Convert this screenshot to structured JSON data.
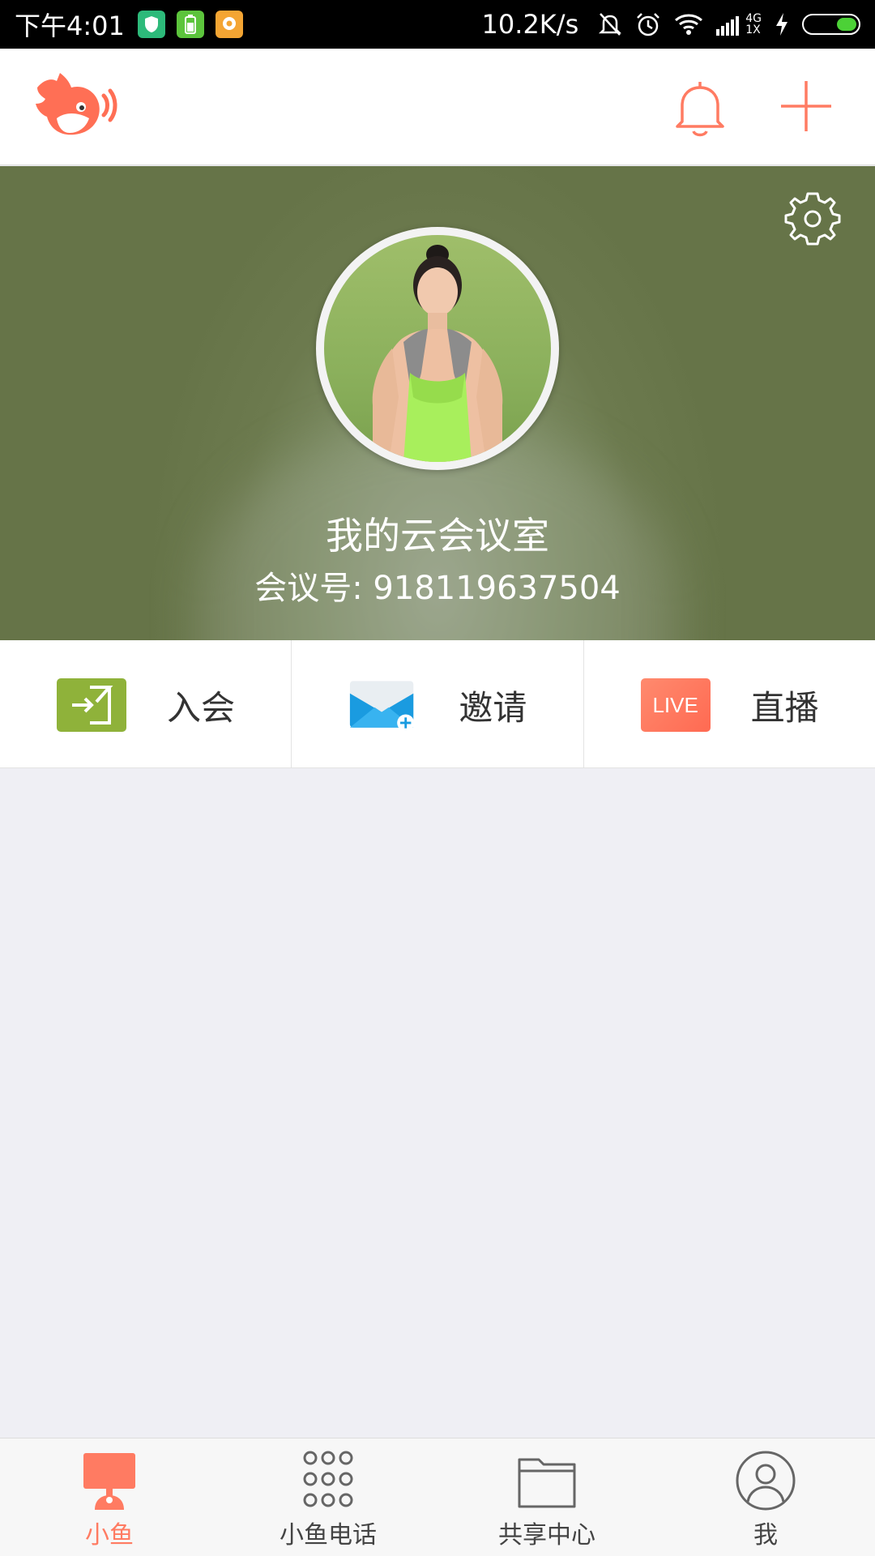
{
  "status_bar": {
    "time": "下午4:01",
    "network_speed": "10.2K/s",
    "signal_top": "4G",
    "signal_bottom": "1X",
    "battery_level": 0.35,
    "app_icons": [
      "shield-app-icon",
      "battery-app-icon",
      "chat-app-icon"
    ]
  },
  "top_bar": {
    "logo": "fish-logo-icon",
    "notification_icon": "bell-icon",
    "add_icon": "plus-icon"
  },
  "hero": {
    "settings_icon": "gear-icon",
    "room_title": "我的云会议室",
    "room_number_label": "会议号: 918119637504"
  },
  "actions": [
    {
      "label": "入会",
      "icon": "join-icon",
      "color": "#8fb23a"
    },
    {
      "label": "邀请",
      "icon": "envelope-icon",
      "color": "#1a9be0"
    },
    {
      "label": "直播",
      "icon": "live-icon",
      "icon_text": "LIVE",
      "color": "#ff7b62"
    }
  ],
  "bottom_nav": [
    {
      "label": "小鱼",
      "icon": "monitor-icon",
      "active": true
    },
    {
      "label": "小鱼电话",
      "icon": "dialpad-icon",
      "active": false
    },
    {
      "label": "共享中心",
      "icon": "folder-icon",
      "active": false
    },
    {
      "label": "我",
      "icon": "person-icon",
      "active": false
    }
  ],
  "colors": {
    "accent": "#ff7b62",
    "background": "#efeff4"
  }
}
